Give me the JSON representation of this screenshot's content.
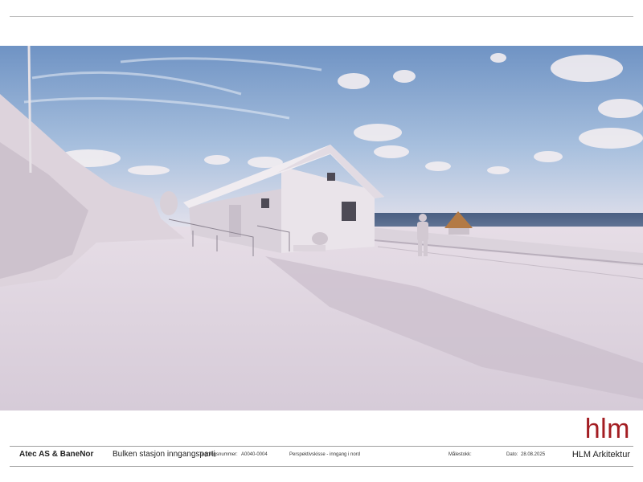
{
  "header": {
    "top_rule": true
  },
  "rendering": {
    "alt": "Perspektivskisse av inngangsparti ved Bulken stasjon"
  },
  "logo": {
    "text": "hlm",
    "color": "#a31d22"
  },
  "title_block": {
    "client": "Atec AS & BaneNor",
    "project": "Bulken stasjon inngangsparti",
    "drawing_number_label": "Tegningsnummer:",
    "drawing_number": "A0040-0004",
    "description": "Perspektivskisse - inngang i nord",
    "scale_label": "Målestokk:",
    "date_label": "Dato:",
    "date": "28.08.2025",
    "office": "HLM Arkitektur"
  }
}
